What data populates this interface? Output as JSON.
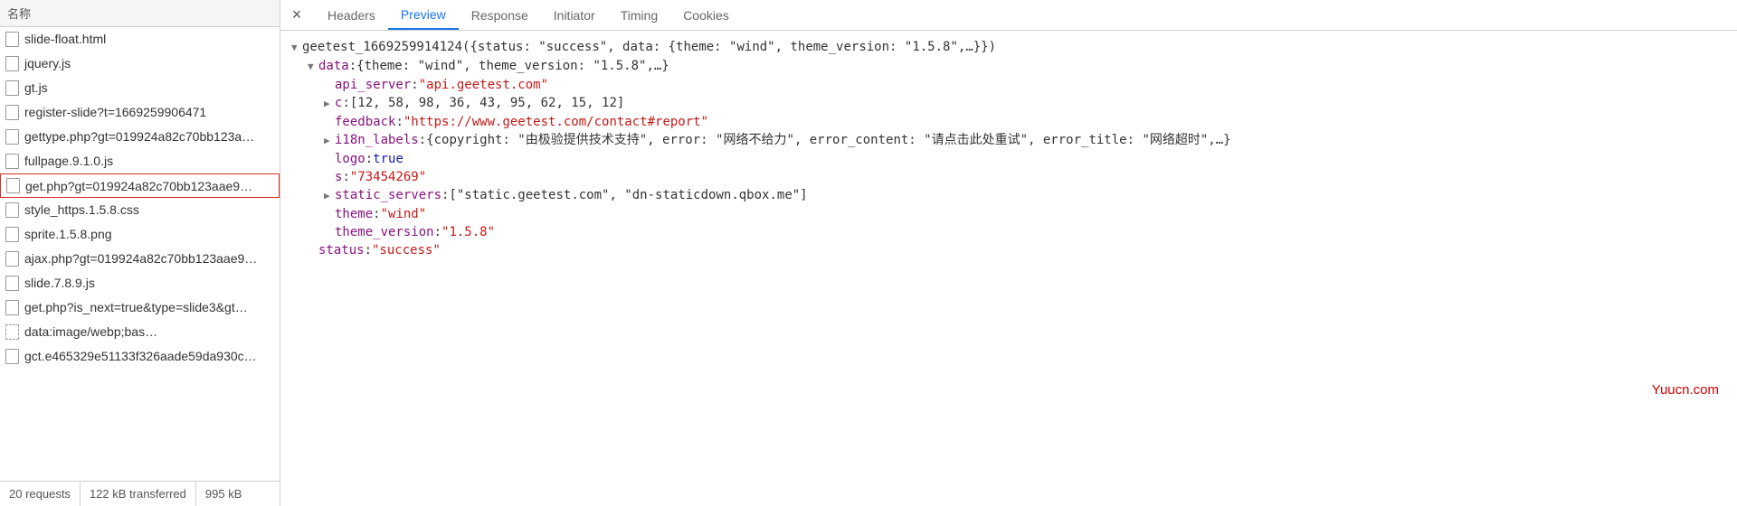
{
  "sidebar": {
    "header": "名称",
    "items": [
      {
        "name": "slide-float.html",
        "dashed": false
      },
      {
        "name": "jquery.js",
        "dashed": false
      },
      {
        "name": "gt.js",
        "dashed": false
      },
      {
        "name": "register-slide?t=1669259906471",
        "dashed": false
      },
      {
        "name": "gettype.php?gt=019924a82c70bb123a…",
        "dashed": false
      },
      {
        "name": "fullpage.9.1.0.js",
        "dashed": false
      },
      {
        "name": "get.php?gt=019924a82c70bb123aae9…",
        "dashed": false,
        "selected": true
      },
      {
        "name": "style_https.1.5.8.css",
        "dashed": false
      },
      {
        "name": "sprite.1.5.8.png",
        "dashed": false
      },
      {
        "name": "ajax.php?gt=019924a82c70bb123aae9…",
        "dashed": false
      },
      {
        "name": "slide.7.8.9.js",
        "dashed": false
      },
      {
        "name": "get.php?is_next=true&type=slide3&gt…",
        "dashed": false
      },
      {
        "name": "data:image/webp;bas…",
        "dashed": true
      },
      {
        "name": "gct.e465329e51133f326aade59da930c…",
        "dashed": false
      }
    ],
    "footer": {
      "requests": "20 requests",
      "transferred": "122 kB transferred",
      "size": "995 kB"
    }
  },
  "tabs": {
    "items": [
      "Headers",
      "Preview",
      "Response",
      "Initiator",
      "Timing",
      "Cookies"
    ],
    "active": 1
  },
  "preview": {
    "callback": "geetest_1669259914124",
    "root_summary": "{status: \"success\", data: {theme: \"wind\", theme_version: \"1.5.8\",…}}",
    "data_label": "data",
    "data_summary": "{theme: \"wind\", theme_version: \"1.5.8\",…}",
    "api_server_key": "api_server",
    "api_server_val": "\"api.geetest.com\"",
    "c_key": "c",
    "c_val": "[12, 58, 98, 36, 43, 95, 62, 15, 12]",
    "feedback_key": "feedback",
    "feedback_val": "\"https://www.geetest.com/contact#report\"",
    "i18n_key": "i18n_labels",
    "i18n_val": "{copyright: \"由极验提供技术支持\", error: \"网络不给力\", error_content: \"请点击此处重试\", error_title: \"网络超时\",…}",
    "logo_key": "logo",
    "logo_val": "true",
    "s_key": "s",
    "s_val": "\"73454269\"",
    "static_key": "static_servers",
    "static_val": "[\"static.geetest.com\", \"dn-staticdown.qbox.me\"]",
    "theme_key": "theme",
    "theme_val": "\"wind\"",
    "themev_key": "theme_version",
    "themev_val": "\"1.5.8\"",
    "status_key": "status",
    "status_val": "\"success\""
  },
  "watermark": "Yuucn.com"
}
